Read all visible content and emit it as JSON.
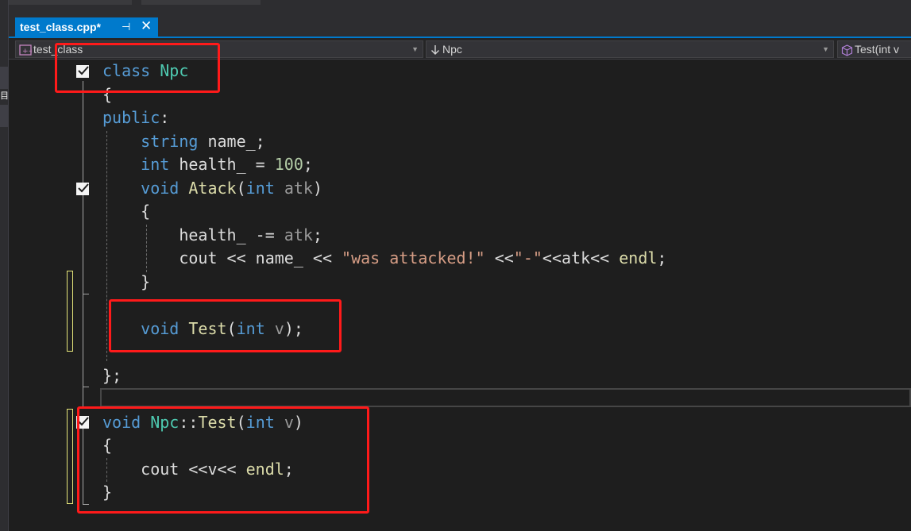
{
  "window": {
    "tab": {
      "title": "test_class.cpp*",
      "pin_glyph": "⊣",
      "close_glyph": "✕",
      "accent": "#007acc"
    },
    "side_glyph": "目"
  },
  "navbar": {
    "project": "test_class",
    "scope": "Npc",
    "member": "Test(int v"
  },
  "code": {
    "lines": [
      [
        [
          "kw",
          "class "
        ],
        [
          "cls",
          "Npc"
        ]
      ],
      [
        [
          "pun",
          "{"
        ]
      ],
      [
        [
          "kw",
          "public"
        ],
        [
          "pun",
          ":"
        ]
      ],
      [
        [
          "pun",
          "    "
        ],
        [
          "kw",
          "string"
        ],
        [
          "pun",
          " name_;"
        ]
      ],
      [
        [
          "pun",
          "    "
        ],
        [
          "kw",
          "int"
        ],
        [
          "pun",
          " health_ = "
        ],
        [
          "num",
          "100"
        ],
        [
          "pun",
          ";"
        ]
      ],
      [
        [
          "pun",
          "    "
        ],
        [
          "kw",
          "void"
        ],
        [
          "pun",
          " "
        ],
        [
          "fn",
          "Atack"
        ],
        [
          "pun",
          "("
        ],
        [
          "kw",
          "int"
        ],
        [
          "pun",
          " "
        ],
        [
          "par",
          "atk"
        ],
        [
          "pun",
          ")"
        ]
      ],
      [
        [
          "pun",
          "    {"
        ]
      ],
      [
        [
          "pun",
          "        health_ -= "
        ],
        [
          "par",
          "atk"
        ],
        [
          "pun",
          ";"
        ]
      ],
      [
        [
          "pun",
          "        cout << name_ << "
        ],
        [
          "str",
          "\"was attacked!\""
        ],
        [
          "pun",
          " <<"
        ],
        [
          "str",
          "\"-\""
        ],
        [
          "pun",
          "<<atk<< "
        ],
        [
          "fn",
          "endl"
        ],
        [
          "pun",
          ";"
        ]
      ],
      [
        [
          "pun",
          "    }"
        ]
      ],
      [],
      [
        [
          "pun",
          "    "
        ],
        [
          "kw",
          "void"
        ],
        [
          "pun",
          " "
        ],
        [
          "fn",
          "Test"
        ],
        [
          "pun",
          "("
        ],
        [
          "kw",
          "int"
        ],
        [
          "pun",
          " "
        ],
        [
          "par",
          "v"
        ],
        [
          "pun",
          ");"
        ]
      ],
      [],
      [
        [
          "pun",
          "};"
        ]
      ],
      [],
      [
        [
          "kw",
          "void"
        ],
        [
          "pun",
          " "
        ],
        [
          "cls",
          "Npc"
        ],
        [
          "pun",
          "::"
        ],
        [
          "fn",
          "Test"
        ],
        [
          "pun",
          "("
        ],
        [
          "kw",
          "int"
        ],
        [
          "pun",
          " "
        ],
        [
          "par",
          "v"
        ],
        [
          "pun",
          ")"
        ]
      ],
      [
        [
          "pun",
          "{"
        ]
      ],
      [
        [
          "pun",
          "    cout <<v<< "
        ],
        [
          "fn",
          "endl"
        ],
        [
          "pun",
          ";"
        ]
      ],
      [
        [
          "pun",
          "}"
        ]
      ]
    ]
  },
  "colors": {
    "keyword": "#569cd6",
    "type": "#4ec9b0",
    "function": "#dcdcaa",
    "number": "#b5cea8",
    "string": "#d69d85",
    "parameter": "#9a9a9a",
    "plain": "#dcdcdc",
    "annotation": "#ff1a1a"
  }
}
